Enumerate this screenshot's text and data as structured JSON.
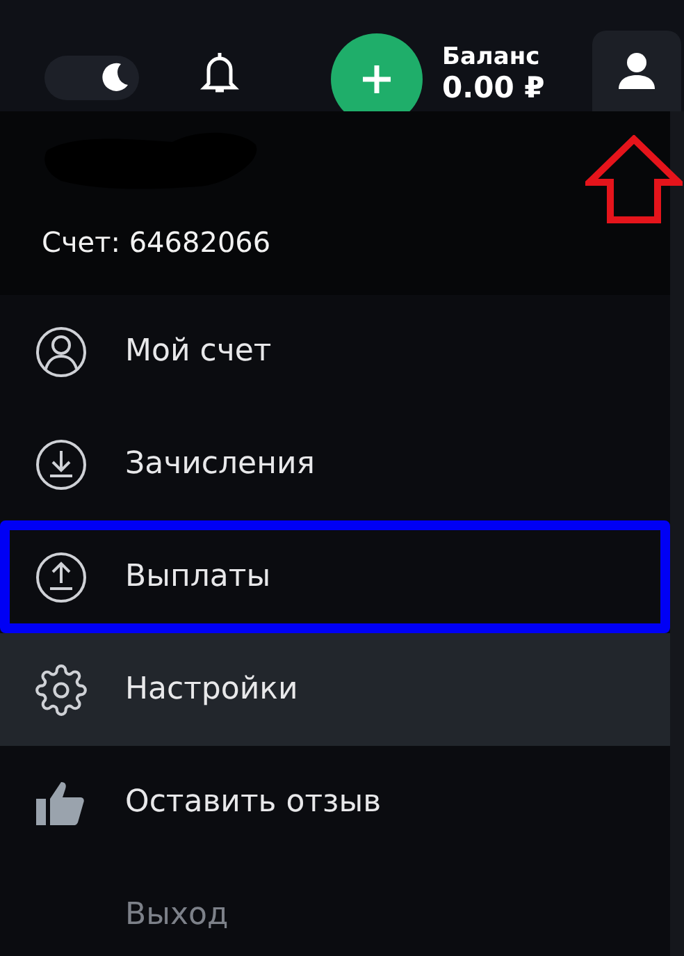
{
  "header": {
    "dark_mode_toggle": {
      "on": true
    },
    "balance": {
      "label": "Баланс",
      "value": "0.00 ₽"
    }
  },
  "account": {
    "number": "Счет: 64682066"
  },
  "menu": [
    {
      "kind": "user",
      "label": "Мой счет",
      "hovered": false,
      "framed": false,
      "dimmed": false
    },
    {
      "kind": "download",
      "label": "Зачисления",
      "hovered": false,
      "framed": false,
      "dimmed": false
    },
    {
      "kind": "upload",
      "label": "Выплаты",
      "hovered": false,
      "framed": true,
      "dimmed": false
    },
    {
      "kind": "gear",
      "label": "Настройки",
      "hovered": true,
      "framed": false,
      "dimmed": false
    },
    {
      "kind": "thumb",
      "label": "Оставить отзыв",
      "hovered": false,
      "framed": false,
      "dimmed": false
    },
    {
      "kind": "none",
      "label": "Выход",
      "hovered": false,
      "framed": false,
      "dimmed": true
    }
  ]
}
